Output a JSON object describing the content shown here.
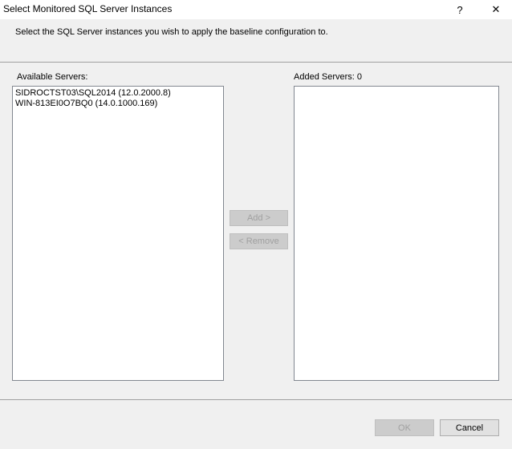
{
  "window": {
    "title": "Select Monitored SQL Server Instances",
    "help_glyph": "?",
    "close_glyph": "✕"
  },
  "instruction": "Select the SQL Server instances you wish to apply the baseline configuration to.",
  "available": {
    "label": "Available Servers:",
    "items": [
      "SIDROCTST03\\SQL2014  (12.0.2000.8)",
      "WIN-813EI0O7BQ0  (14.0.1000.169)"
    ]
  },
  "added": {
    "label": "Added Servers: 0",
    "items": []
  },
  "buttons": {
    "add": "Add >",
    "remove": "< Remove",
    "ok": "OK",
    "cancel": "Cancel"
  },
  "colors": {
    "titlebar_bg": "#ffffff",
    "dialog_bg": "#f0f0f0",
    "disabled_text": "#a0a0a0"
  }
}
